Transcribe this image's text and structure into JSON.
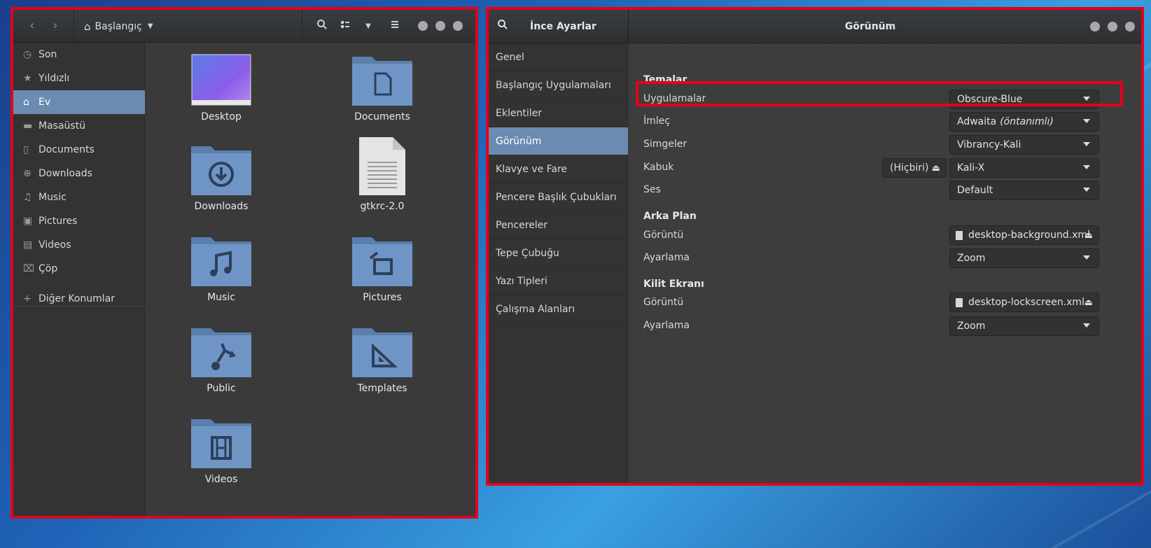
{
  "file_manager": {
    "location": "Başlangıç",
    "sidebar": [
      {
        "label": "Son",
        "icon": "recent-icon"
      },
      {
        "label": "Yıldızlı",
        "icon": "star-icon"
      },
      {
        "label": "Ev",
        "icon": "home-icon",
        "active": true
      },
      {
        "label": "Masaüstü",
        "icon": "desktop-folder-icon"
      },
      {
        "label": "Documents",
        "icon": "document-icon"
      },
      {
        "label": "Downloads",
        "icon": "download-icon"
      },
      {
        "label": "Music",
        "icon": "music-icon"
      },
      {
        "label": "Pictures",
        "icon": "pictures-icon"
      },
      {
        "label": "Videos",
        "icon": "video-icon"
      },
      {
        "label": "Çöp",
        "icon": "trash-icon"
      },
      {
        "label": "Diğer Konumlar",
        "icon": "plus-icon"
      }
    ],
    "files": [
      {
        "name": "Desktop",
        "icon": "desktop-wallpaper-icon"
      },
      {
        "name": "Documents",
        "icon": "documents-folder-icon"
      },
      {
        "name": "Downloads",
        "icon": "downloads-folder-icon"
      },
      {
        "name": "gtkrc-2.0",
        "icon": "text-file-icon"
      },
      {
        "name": "Music",
        "icon": "music-folder-icon"
      },
      {
        "name": "Pictures",
        "icon": "pictures-folder-icon"
      },
      {
        "name": "Public",
        "icon": "public-folder-icon"
      },
      {
        "name": "Templates",
        "icon": "templates-folder-icon"
      },
      {
        "name": "Videos",
        "icon": "videos-folder-icon"
      }
    ]
  },
  "tweaks": {
    "app_title": "İnce Ayarlar",
    "page_title": "Görünüm",
    "sidebar": [
      {
        "label": "Genel"
      },
      {
        "label": "Başlangıç Uygulamaları"
      },
      {
        "label": "Eklentiler"
      },
      {
        "label": "Görünüm",
        "active": true
      },
      {
        "label": "Klavye ve Fare"
      },
      {
        "label": "Pencere Başlık Çubukları"
      },
      {
        "label": "Pencereler"
      },
      {
        "label": "Tepe Çubuğu"
      },
      {
        "label": "Yazı Tipleri"
      },
      {
        "label": "Çalışma Alanları"
      }
    ],
    "themes": {
      "title": "Temalar",
      "applications": {
        "label": "Uygulamalar",
        "value": "Obscure-Blue"
      },
      "cursor": {
        "label": "İmleç",
        "value": "Adwaita",
        "note": "(öntanımlı)"
      },
      "icons": {
        "label": "Simgeler",
        "value": "Vibrancy-Kali"
      },
      "shell": {
        "label": "Kabuk",
        "none_label": "(Hiçbiri)",
        "value": "Kali-X"
      },
      "sound": {
        "label": "Ses",
        "value": "Default"
      }
    },
    "background": {
      "title": "Arka Plan",
      "image": {
        "label": "Görüntü",
        "value": "desktop-background.xml"
      },
      "adjustment": {
        "label": "Ayarlama",
        "value": "Zoom"
      }
    },
    "lockscreen": {
      "title": "Kilit Ekranı",
      "image": {
        "label": "Görüntü",
        "value": "desktop-lockscreen.xml"
      },
      "adjustment": {
        "label": "Ayarlama",
        "value": "Zoom"
      }
    }
  },
  "colors": {
    "highlight": "#e3001b",
    "selection": "#6b8cb0",
    "folder_blue": "#6f95c7"
  }
}
